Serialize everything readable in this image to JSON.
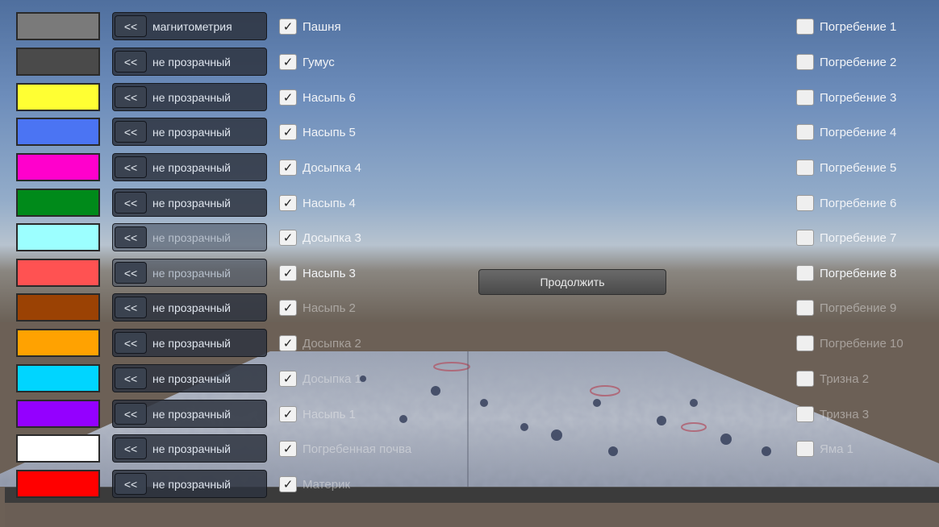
{
  "layers": [
    {
      "color": "#7a7a7a",
      "mode": "магнитометрия",
      "label": "Пашня",
      "checked": true
    },
    {
      "color": "#4a4a4a",
      "mode": "не прозрачный",
      "label": "Гумус",
      "checked": true
    },
    {
      "color": "#ffff33",
      "mode": "не прозрачный",
      "label": "Насыпь 6",
      "checked": true
    },
    {
      "color": "#4b74f3",
      "mode": "не прозрачный",
      "label": "Насыпь 5",
      "checked": true
    },
    {
      "color": "#ff00cc",
      "mode": "не прозрачный",
      "label": "Досыпка 4",
      "checked": true
    },
    {
      "color": "#008a1a",
      "mode": "не прозрачный",
      "label": "Насыпь 4",
      "checked": true
    },
    {
      "color": "#9cffff",
      "mode": "не прозрачный",
      "label": "Досыпка 3",
      "checked": true
    },
    {
      "color": "#ff5252",
      "mode": "не прозрачный",
      "label": "Насыпь 3",
      "checked": true
    },
    {
      "color": "#9b4204",
      "mode": "не прозрачный",
      "label": "Насыпь 2",
      "checked": true
    },
    {
      "color": "#ffa201",
      "mode": "не прозрачный",
      "label": "Досыпка 2",
      "checked": true
    },
    {
      "color": "#00d5ff",
      "mode": "не прозрачный",
      "label": "Досыпка 1",
      "checked": true
    },
    {
      "color": "#9400ff",
      "mode": "не прозрачный",
      "label": "Насыпь 1",
      "checked": true
    },
    {
      "color": "#ffffff",
      "mode": "не прозрачный",
      "label": "Погребенная почва",
      "checked": true
    },
    {
      "color": "#ff0000",
      "mode": "не прозрачный",
      "label": "Материк",
      "checked": true
    }
  ],
  "arrow_label": "<<",
  "check_mark": "✓",
  "burials": [
    "Погребение 1",
    "Погребение 2",
    "Погребение 3",
    "Погребение 4",
    "Погребение 5",
    "Погребение 6",
    "Погребение 7",
    "Погребение 8",
    "Погребение 9",
    "Погребение 10",
    "Тризна 2",
    "Тризна 3",
    "Яма 1"
  ],
  "continue_label": "Продолжить"
}
